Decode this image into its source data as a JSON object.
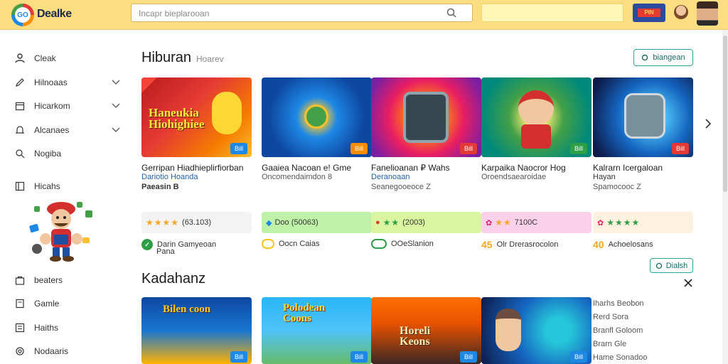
{
  "header": {
    "brand": "Dealke",
    "logo_text": "GO",
    "search_placeholder": "Incapr bieplarooan",
    "flag_badge_text": "PIN"
  },
  "sidebar": {
    "items": [
      {
        "label": "Cleak",
        "icon": "person-icon"
      },
      {
        "label": "Hilnoaas",
        "icon": "pen-icon"
      },
      {
        "label": "Hicarkom",
        "icon": "calendar-icon"
      },
      {
        "label": "Alcanaes",
        "icon": "bell-icon"
      },
      {
        "label": "Nogiba",
        "icon": "search-icon"
      },
      {
        "label": "Hicahs",
        "icon": "grid-icon"
      },
      {
        "label": "beaters",
        "icon": "bag-icon"
      },
      {
        "label": "Gamle",
        "icon": "doc-icon"
      },
      {
        "label": "Haiths",
        "icon": "list-icon"
      },
      {
        "label": "Nodaaris",
        "icon": "gear-icon"
      }
    ]
  },
  "section1": {
    "title": "Hiburan",
    "subtitle": "Hoarev",
    "button_label": "biangean",
    "cards": [
      {
        "image_text": "Haneukia Hiohighiee",
        "tag": "Bill",
        "tag_color": "#1e88e5",
        "title": "Gerripan Hiadhieplirfiorban",
        "subtitle": "Dariotio Hoanda",
        "meta": "Paeasin B",
        "rating_text": "(63.103)",
        "rating_bg": "#f3f3f3",
        "stars": "★★★★",
        "star_class": "stars",
        "footer_text": "Darin Gamyeoan",
        "footer_line2": "Pana",
        "footer_icon_color": "#2e9e47",
        "footer_icon": "✓"
      },
      {
        "image_text": "",
        "tag": "Bill",
        "tag_color": "#fb8c00",
        "title": "Gaaiea Nacoan e! Gme",
        "subtitle": "Oncomendaimdon 8",
        "meta": "",
        "rating_text": "Doo (50063)",
        "rating_bg": "#bff2a8",
        "stars": "",
        "star_class": "stars",
        "footer_text": "Oocn Caias",
        "footer_line2": "",
        "footer_icon_color": "#f5c518",
        "footer_icon": "○"
      },
      {
        "image_text": "",
        "tag": "Bill",
        "tag_color": "#e53935",
        "title": "Fanelioanan ₽ Wahs",
        "subtitle": "Deranoaan",
        "meta": "Seanegooeoce Z",
        "rating_text": "(2003)",
        "rating_bg": "#d9f5a0",
        "stars": "★★",
        "star_class": "stars green",
        "footer_text": "OOeSlanion",
        "footer_line2": "",
        "footer_icon_color": "#2e9e47",
        "footer_icon": "●"
      },
      {
        "image_text": "",
        "tag": "Bill",
        "tag_color": "#2e9e47",
        "title": "Karpaika Naocror Hog",
        "subtitle": "Oroendsaearoidae",
        "meta": "",
        "rating_text": "7100C",
        "rating_bg": "#fbd1e9",
        "stars": "★★",
        "star_class": "stars",
        "footer_text": "Olr Drerasrocolon",
        "footer_line2": "",
        "footer_icon_color": "#f5a623",
        "footer_icon": "45"
      },
      {
        "image_text": "",
        "tag": "Bill",
        "tag_color": "#e53935",
        "title": "Kalrarn Icergaloan",
        "subtitle": "Hayan",
        "meta": "Spamocooc Z",
        "rating_text": "",
        "rating_bg": "#fff1e0",
        "stars": "★★★★",
        "star_class": "stars green",
        "footer_text": "Achoelosans",
        "footer_line2": "",
        "footer_icon_color": "#f5a623",
        "footer_icon": "40"
      }
    ]
  },
  "section2": {
    "title": "Kadahanz",
    "button_label": "Dialsh",
    "cards": [
      {
        "image_text": "Bilen coon",
        "tag": "Bill",
        "tag_color": "#1e88e5"
      },
      {
        "image_text": "Polodean Coons",
        "tag": "Bill",
        "tag_color": "#1e88e5"
      },
      {
        "image_text": "Horeli Keons",
        "tag": "Bill",
        "tag_color": "#1e88e5"
      },
      {
        "image_text": "",
        "tag": "Bill",
        "tag_color": "#1e88e5"
      }
    ],
    "list": [
      "Iharhs Beobon",
      "Rerd Sora",
      "Branfl Goloom",
      "Brarn Gle",
      "Hame Sonadoo"
    ]
  },
  "colors": {
    "header_bg": "#fbdd82",
    "accent": "#2aa6a0"
  }
}
